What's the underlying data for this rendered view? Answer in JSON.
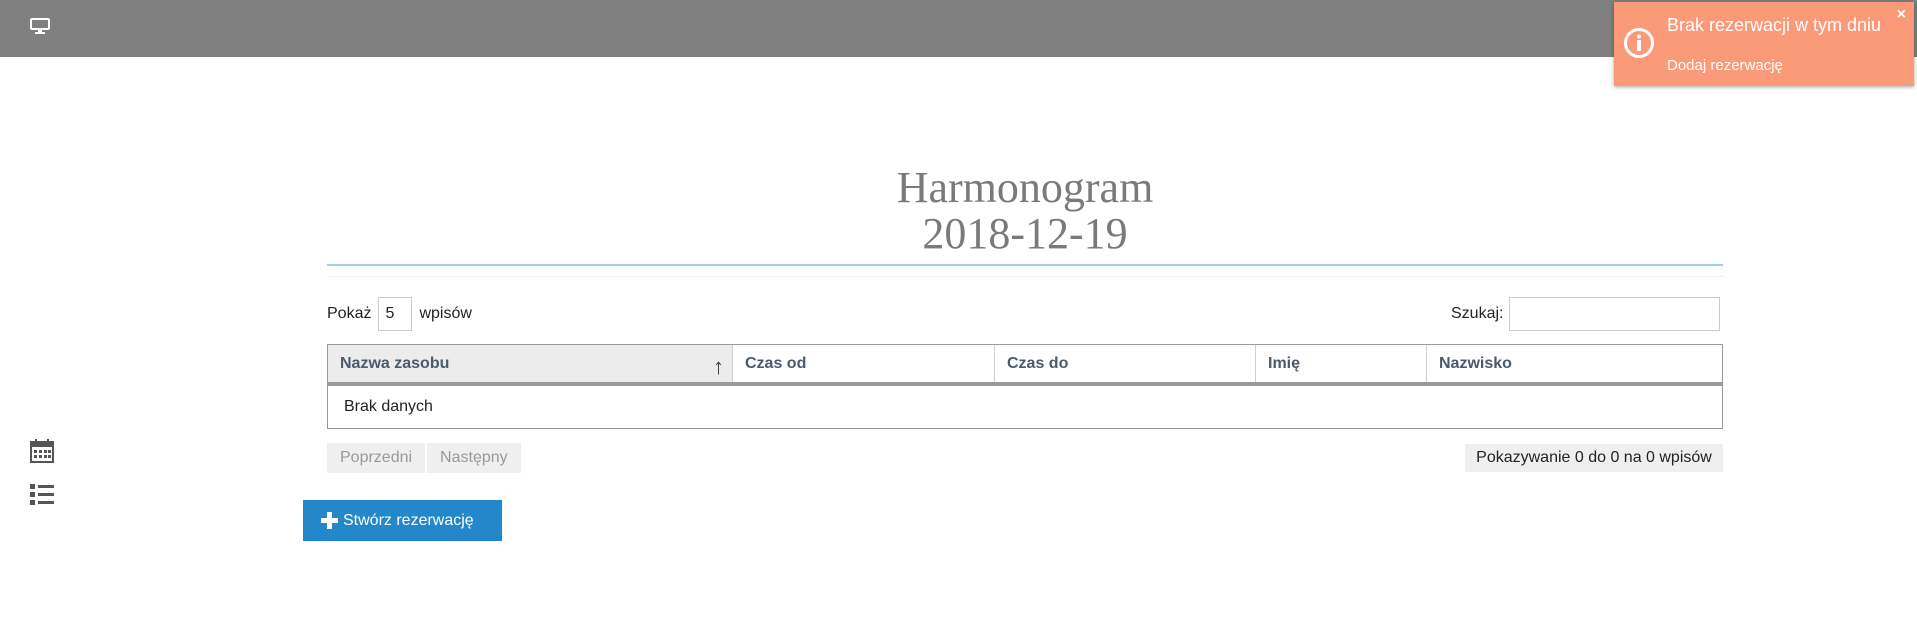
{
  "topbar": {
    "icon": "monitor-icon"
  },
  "toast": {
    "title": "Brak rezerwacji w tym dniu",
    "subtitle": "Dodaj rezerwację",
    "close": "×",
    "icon": "info-icon",
    "color": "#fa9a78"
  },
  "sidebar": {
    "icons": [
      "calendar-icon",
      "list-icon"
    ]
  },
  "header": {
    "title_line1": "Harmonogram",
    "title_line2": "2018-12-19"
  },
  "table_controls": {
    "show_label": "Pokaż",
    "page_length": "5",
    "entries_label": "wpisów",
    "search_label": "Szukaj:",
    "search_value": ""
  },
  "table": {
    "columns": [
      "Nazwa zasobu",
      "Czas od",
      "Czas do",
      "Imię",
      "Nazwisko"
    ],
    "sort_indicator": "↑",
    "empty_message": "Brak danych"
  },
  "pagination": {
    "prev_label": "Poprzedni",
    "next_label": "Następny",
    "info": "Pokazywanie 0 do 0 na 0 wpisów"
  },
  "actions": {
    "create_label": "Stwórz rezerwację",
    "accent_color": "#2387c9"
  }
}
